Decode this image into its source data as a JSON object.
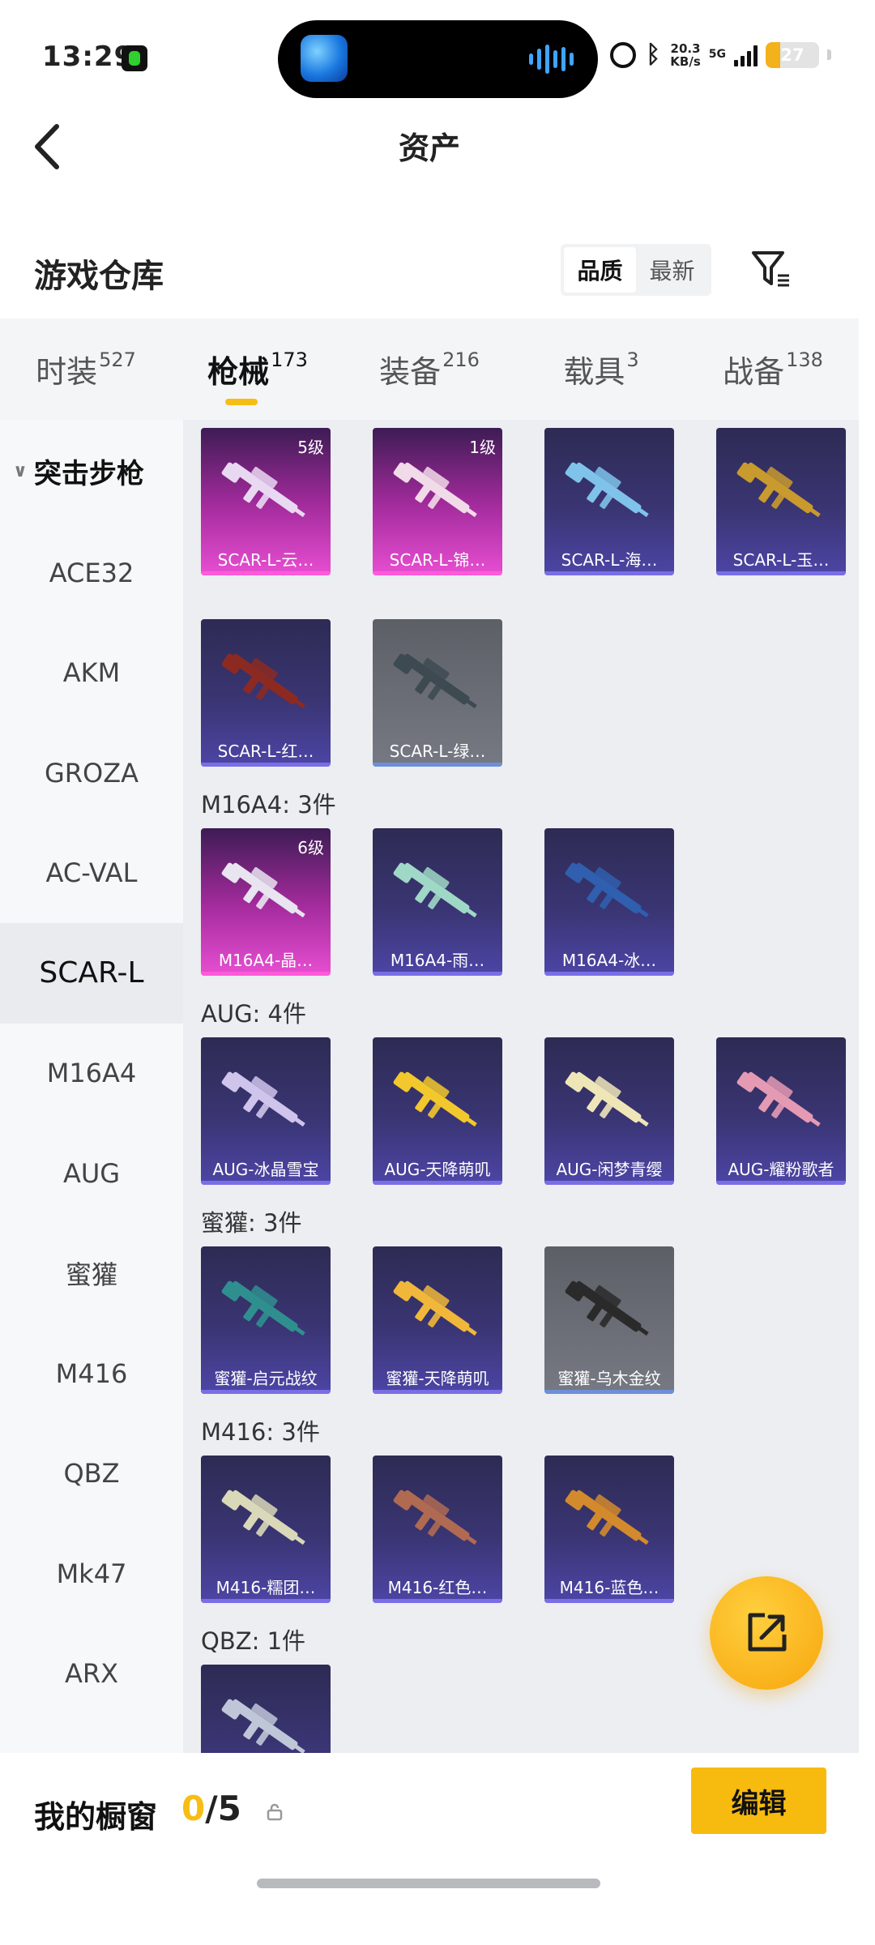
{
  "status": {
    "time": "13:29",
    "speed_value": "20.3",
    "speed_unit": "KB/s",
    "network": "5G",
    "battery": "27",
    "battery_level_percent": 27
  },
  "header": {
    "title": "资产"
  },
  "section": {
    "title": "游戏仓库",
    "sort_options": [
      "品质",
      "最新"
    ],
    "active_sort": "品质"
  },
  "category_tabs": [
    {
      "label": "时装",
      "count": "527"
    },
    {
      "label": "枪械",
      "count": "173"
    },
    {
      "label": "装备",
      "count": "216"
    },
    {
      "label": "载具",
      "count": "3"
    },
    {
      "label": "战备",
      "count": "138"
    }
  ],
  "active_category": "枪械",
  "left_nav": {
    "group": "突击步枪",
    "items": [
      "ACE32",
      "AKM",
      "GROZA",
      "AC-VAL",
      "SCAR-L",
      "M16A4",
      "AUG",
      "蜜獾",
      "M416",
      "QBZ",
      "Mk47",
      "ARX"
    ],
    "active": "SCAR-L"
  },
  "groups": [
    {
      "heading": "",
      "items": [
        {
          "label": "SCAR-L-云…",
          "rarity": "pink",
          "level": "5级",
          "gun_color": "#e9d8f2"
        },
        {
          "label": "SCAR-L-锦…",
          "rarity": "pink",
          "level": "1级",
          "gun_color": "#f1dbe8"
        },
        {
          "label": "SCAR-L-海…",
          "rarity": "purple",
          "level": "",
          "gun_color": "#7fc3ea"
        },
        {
          "label": "SCAR-L-玉…",
          "rarity": "purple",
          "level": "",
          "gun_color": "#c99a2d"
        },
        {
          "label": "SCAR-L-红…",
          "rarity": "purple",
          "level": "",
          "gun_color": "#8c2a22"
        },
        {
          "label": "SCAR-L-绿…",
          "rarity": "gray",
          "level": "",
          "gun_color": "#3e4a52"
        }
      ]
    },
    {
      "heading": "M16A4: 3件",
      "items": [
        {
          "label": "M16A4-晶…",
          "rarity": "pink",
          "level": "6级",
          "gun_color": "#e8e4f0"
        },
        {
          "label": "M16A4-雨…",
          "rarity": "purple",
          "level": "",
          "gun_color": "#9fd8c6"
        },
        {
          "label": "M16A4-冰…",
          "rarity": "purple",
          "level": "",
          "gun_color": "#2f5fae"
        }
      ]
    },
    {
      "heading": "AUG: 4件",
      "items": [
        {
          "label": "AUG-冰晶雪宝",
          "rarity": "purple",
          "level": "",
          "gun_color": "#cfc4ec"
        },
        {
          "label": "AUG-天降萌叽",
          "rarity": "purple",
          "level": "",
          "gun_color": "#f2c82c"
        },
        {
          "label": "AUG-闲梦青缨",
          "rarity": "purple",
          "level": "",
          "gun_color": "#efe6b8"
        },
        {
          "label": "AUG-耀粉歌者",
          "rarity": "purple",
          "level": "",
          "gun_color": "#e59ab4"
        }
      ]
    },
    {
      "heading": "蜜獾: 3件",
      "items": [
        {
          "label": "蜜獾-启元战纹",
          "rarity": "purple",
          "level": "",
          "gun_color": "#2f8f8f"
        },
        {
          "label": "蜜獾-天降萌叽",
          "rarity": "purple",
          "level": "",
          "gun_color": "#f0b73a"
        },
        {
          "label": "蜜獾-乌木金纹",
          "rarity": "gray",
          "level": "",
          "gun_color": "#2a2a2a"
        }
      ]
    },
    {
      "heading": "M416: 3件",
      "items": [
        {
          "label": "M416-糯团…",
          "rarity": "purple",
          "level": "",
          "gun_color": "#d9d8b8"
        },
        {
          "label": "M416-红色…",
          "rarity": "purple",
          "level": "",
          "gun_color": "#b06a52"
        },
        {
          "label": "M416-蓝色…",
          "rarity": "purple",
          "level": "",
          "gun_color": "#d38a2c"
        }
      ]
    },
    {
      "heading": "QBZ: 1件",
      "items": [
        {
          "label": "",
          "rarity": "purple",
          "level": "",
          "gun_color": "#bfc6d8"
        }
      ]
    }
  ],
  "bottom": {
    "label": "我的橱窗",
    "count_current": "0",
    "count_total": "/5",
    "edit": "编辑"
  },
  "icons": {
    "back": "chevron-left-icon",
    "filter": "filter-icon",
    "fab": "share-icon",
    "lock": "lock-icon"
  }
}
